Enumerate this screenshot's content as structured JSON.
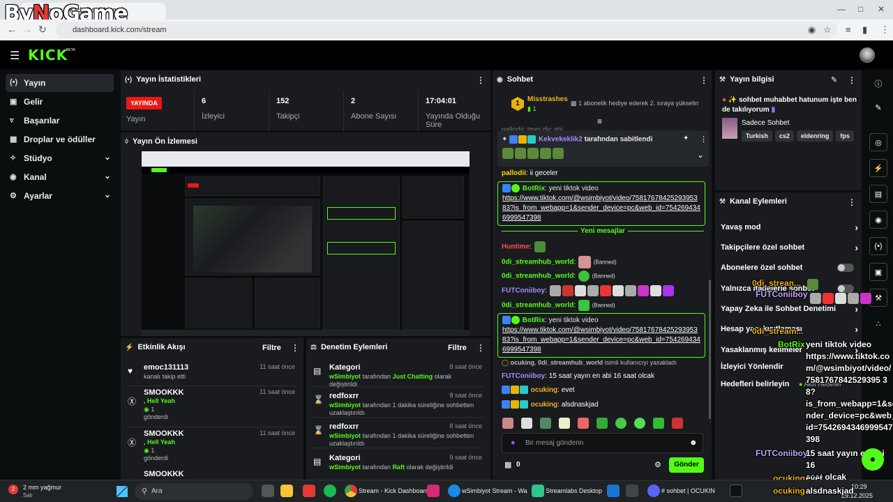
{
  "browser": {
    "tab_title": "Stream - Kick Dashboard",
    "url": "dashboard.kick.com/stream",
    "brand_overlay": "ByNoGame"
  },
  "header": {
    "logo": "KICK",
    "logo_tag": "BETA"
  },
  "sidebar": {
    "items": [
      {
        "label": "Yayın",
        "active": true
      },
      {
        "label": "Gelir"
      },
      {
        "label": "Başarılar"
      },
      {
        "label": "Droplar ve ödüller"
      },
      {
        "label": "Stüdyo",
        "expandable": true
      },
      {
        "label": "Kanal",
        "expandable": true
      },
      {
        "label": "Ayarlar",
        "expandable": true
      }
    ]
  },
  "stats": {
    "title": "Yayın İstatistikleri",
    "live_badge": "YAYINDA",
    "live_label": "Yayın",
    "items": [
      {
        "value": "6",
        "label": "İzleyici"
      },
      {
        "value": "152",
        "label": "Takipçi"
      },
      {
        "value": "2",
        "label": "Abone Sayısı"
      },
      {
        "value": "17:04:01",
        "label": "Yayında Olduğu Süre"
      }
    ]
  },
  "preview": {
    "title": "Yayın Ön İzlemesi"
  },
  "activity": {
    "title": "Etkinlik Akışı",
    "filter": "Filtre",
    "rows": [
      {
        "name": "emoc131113",
        "time": "11 saat önce",
        "sub": "kanalı takip etti"
      },
      {
        "name": "SMOOKKK",
        "time": "11 saat önce",
        "msg": ", Hell Yeah",
        "count": "1",
        "sub": "gönderdi"
      },
      {
        "name": "SMOOKKK",
        "time": "11 saat önce",
        "msg": ", Hell Yeah",
        "count": "1",
        "sub": "gönderdi"
      },
      {
        "name": "SMOOKKK"
      }
    ]
  },
  "moderation": {
    "title": "Denetim Eylemleri",
    "filter": "Filtre",
    "rows": [
      {
        "name": "Kategori",
        "time": "8 saat önce",
        "actor": "wSimbiyot",
        "mid": " tarafından ",
        "hl": "Just Chatting",
        "tail": " olarak değiştirildi"
      },
      {
        "name": "redfoxrr",
        "time": "8 saat önce",
        "actor": "wSimbiyot",
        "mid": " tarafından 1 dakika süreliğine sohbetten uzaklaştırıldı"
      },
      {
        "name": "redfoxrr",
        "time": "8 saat önce",
        "actor": "wSimbiyot",
        "mid": " tarafından 1 dakika süreliğine sohbetten uzaklaştırıldı"
      },
      {
        "name": "Kategori",
        "time": "9 saat önce",
        "actor": "wSimbiyot",
        "mid": " tarafından ",
        "hl": "Raft",
        "tail": "  olarak değiştirildi"
      }
    ]
  },
  "chat": {
    "title": "Sohbet",
    "top_user": "Misstrashes",
    "top_user_count": "1",
    "top_note": "1 abonelik hediye ederek 2. sıraya yükselin",
    "cut_line": "pallodii: tmm dic ahi",
    "pinned_user": "Kekvekeklik2",
    "pinned_note": " tarafından sabitlendi",
    "messages": [
      {
        "user": "pallodii",
        "text": "ii geceler"
      }
    ],
    "bot1_user": "BotRix",
    "bot1_text": "yeni tiktok video",
    "bot1_link": "https://www.tiktok.com/@wsimbiyot/video/7581767842529395383?is_from_webapp=1&sender_device=pc&web_id=7542694346999547398",
    "new_messages": "Yeni mesajlar",
    "huntime": "Huntime",
    "banned_user": "0di_streamhub_world",
    "banned_label": "(Banned)",
    "futc": "FUTConiiboy",
    "bot2_user": "BotRix",
    "bot2_text": "yeni tiktok video",
    "bot2_link": "https://www.tiktok.com/@wsimbiyot/video/7581767842529395383?is_from_webapp=1&sender_device=pc&web_id=7542694346999547398",
    "ban_notice_user": "ocuking",
    "ban_notice_target": "0di_streamhub_world",
    "ban_notice_text": " isimli kullanıcıyı yasakladı",
    "futc_text": "15 saat yayın en abi 16 saat olcak",
    "ocu1_user": "ocuking",
    "ocu1_text": "evet",
    "ocu2_user": "ocuking",
    "ocu2_text": "alsdnaskjad",
    "input_placeholder": "Bir mesaj gönderin",
    "points": "0",
    "send": "Gönder"
  },
  "stream_info": {
    "title": "Yayın bilgisi",
    "stream_title": "sohbet muhabbet hatunum işte ben de takılıyorum",
    "category": "Sadece Sohbet",
    "tags": [
      "Turkish",
      "cs2",
      "eldenring",
      "fps"
    ]
  },
  "channel_actions": {
    "title": "Kanal Eylemleri",
    "items": [
      {
        "label": "Yavaş mod",
        "type": "chevron"
      },
      {
        "label": "Takipçilere özel sohbet",
        "type": "chevron"
      },
      {
        "label": "Abonelere özel sohbet",
        "type": "toggle"
      },
      {
        "label": "Yalnızca ifadelerle sohbet",
        "type": "toggle"
      },
      {
        "label": "Yapay Zeka ile Sohbet Denetimi",
        "type": "chevron"
      },
      {
        "label": "Hesap yaşı kısıtlaması",
        "type": "chevron"
      },
      {
        "label": "Yasaklanmış kelimeler",
        "type": "chevron"
      },
      {
        "label": "İzleyici Yönlendir",
        "type": "none"
      },
      {
        "label": "Hedefleri belirleyin",
        "type": "none"
      }
    ],
    "goal_status": "Aktif Hedefler"
  },
  "overlay": {
    "lines": [
      {
        "user": "0di_strean...",
        "text": ""
      },
      {
        "user": "FUTConiiboy",
        "text": ""
      },
      {
        "user": "0di_stream...",
        "text": ""
      },
      {
        "user": "BotRix",
        "text": "yeni tiktok video"
      }
    ],
    "bot_link_lines": [
      "https://www.tiktok.co",
      "m/@wsimbiyot/video/",
      "7581767842529395 3",
      "8?",
      "is_from_webapp=1&se",
      "nder_device=pc&web_",
      "id=7542694346999547",
      "398"
    ],
    "futc_user": "FUTConiiboy",
    "futc_lines": [
      "15 saat yayın en abi 16",
      "saat olcak"
    ],
    "ocu1_user": "ocuking",
    "ocu1_text": "evet",
    "ocu2_user": "ocuking",
    "ocu2_text": "alsdnaskjad"
  },
  "taskbar": {
    "weather": "2 mm yağmur",
    "weather_sub": "Salı",
    "search": "Ara",
    "apps": [
      "Stream - Kick Dashboard",
      "wSimbiyot Stream - Wa",
      "Streamlabs Desktop",
      "#​ sohbet | OCUKIN"
    ],
    "time": "10:29",
    "date": "29.12.2025"
  },
  "colors": {
    "accent": "#53fc18",
    "live": "#e91916",
    "panel": "#191b1f",
    "bg": "#0b0e0f"
  }
}
